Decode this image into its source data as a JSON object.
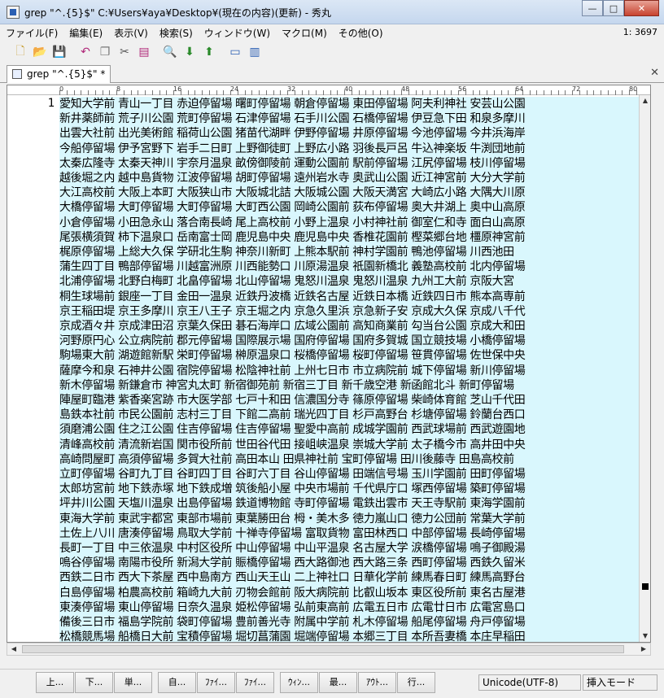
{
  "window": {
    "title": "grep \"^.{5}$\" C:¥Users¥aya¥Desktop¥(現在の内容)(更新) - 秀丸",
    "minimize": "—",
    "maximize": "□",
    "close": "✕"
  },
  "menubar": {
    "items": [
      "ファイル(F)",
      "編集(E)",
      "表示(V)",
      "検索(S)",
      "ウィンドウ(W)",
      "マクロ(M)",
      "その他(O)"
    ],
    "position": "1: 3697"
  },
  "tab": {
    "label": "grep \"^.{5}$\" *",
    "close": "✕"
  },
  "ruler": {
    "marks": [
      "0",
      "8",
      "16",
      "24",
      "32",
      "40",
      "48",
      "56",
      "64",
      "72",
      "80"
    ]
  },
  "editor": {
    "line_number": "1",
    "lines": [
      "愛知大学前 青山一丁目 赤迫停留場 曙町停留場 朝倉停留場 東田停留場 阿夫利神社 安芸山公園",
      "新井薬師前 荒子川公園 荒町停留場 石津停留場 石手川公園 石橋停留場 伊豆急下田 和泉多摩川",
      "出雲大社前 出光美術館 稲荷山公園 猪苗代湖畔 伊野停留場 井原停留場 今池停留場 今井浜海岸",
      "今船停留場 伊予宮野下 岩手二日町 上野御徒町 上野広小路 羽後長戸呂 牛込神楽坂 牛渕団地前",
      "太秦広隆寺 太秦天神川 宇奈月温泉 畝傍御陵前 運動公園前 駅前停留場 江尻停留場 枝川停留場",
      "越後堀之内 越中島貨物 江波停留場 胡町停留場 遠州岩水寺 奥武山公園 近江神宮前 大分大学前",
      "大江高校前 大阪上本町 大阪狭山市 大阪城北詰 大阪城公園 大阪天満宮 大崎広小路 大隅大川原",
      "大橋停留場 大町停留場 大町停留場 大町西公園 岡崎公園前 荻布停留場 奥大井湖上 奥中山高原",
      "小倉停留場 小田急永山 落合南長崎 尾上高校前 小野上温泉 小村神社前 御室仁和寺 面白山高原",
      "尾張横須賀 柿下温泉口 岳南富士岡 鹿児島中央 鹿児島中央 香椎花園前 樫菜郷台地 橿原神宮前",
      "梶原停留場 上総大久保 学研北生駒 神奈川新町 上熊本駅前 神村学園前 鴨池停留場 川西池田",
      "蒲生四丁目 鴨部停留場 川越富洲原 川西能勢口 川原湯温泉 祇園新橋北 義塾高校前 北内停留場",
      "北浦停留場 北野白梅町 北畠停留場 北山停留場 鬼怒川温泉 鬼怒川温泉 九州工大前 京阪大宮",
      "桐生球場前 銀座一丁目 金田一温泉 近鉄丹波橋 近鉄名古屋 近鉄日本橋 近鉄四日市 熊本高専前",
      "京王稲田堤 京王多摩川 京王八王子 京王堀之内 京急久里浜 京急新子安 京成大久保 京成八千代",
      "京成酒々井 京成津田沼 京葉久保田 碁石海岸口 広域公園前 高知商業前 勾当台公園 京成大和田",
      "河野原円心 公立病院前 郡元停留場 国際展示場 国府停留場 国府多賀城 国立競技場 小橋停留場",
      "駒場東大前 湖遊館新駅 栄町停留場 榊原温泉口 桜橋停留場 桜町停留場 笹貫停留場 佐世保中央",
      "薩摩今和泉 石神井公園 宿院停留場 松陰神社前 上州七日市 市立病院前 城下停留場 新川停留場",
      "新木停留場 新鎌倉市 神宮丸太町 新宿御苑前 新宿三丁目 新千歳空港 新函館北斗 新町停留場",
      "陣屋町臨港 紫香楽宮跡 市大医学部 七戸十和田 信濃国分寺 篠原停留場 柴崎体育館 芝山千代田",
      "島鉄本社前 市民公園前 志村三丁目 下館二高前 瑞光四丁目 杉戸高野台 杉塘停留場 鈴蘭台西口",
      "須磨浦公園 住之江公園 住吉停留場 住吉停留場 聖愛中高前 成城学園前 西武球場前 西武遊園地",
      "清峰高校前 清流新岩国 関市役所前 世田谷代田 接岨峡温泉 崇城大学前 太子橋今市 高井田中央",
      "高崎問屋町 高須停留場 多賀大社前 高田本山 田県神社前 宝町停留場 田川後藤寺 田島高校前",
      "立町停留場 谷町九丁目 谷町四丁目 谷町六丁目 谷山停留場 田端信号場 玉川学園前 田町停留場",
      "太郎坊宮前 地下鉄赤塚 地下鉄成増 筑後船小屋 中央市場前 千代県庁口 塚西停留場 築町停留場",
      "坪井川公園 天塩川温泉 出島停留場 鉄道博物館 寺町停留場 電鉄出雲市 天王寺駅前 東海学園前",
      "東海大学前 東武宇都宮 東部市場前 東葉勝田台 栂・美木多 徳力嵐山口 徳力公団前 常葉大学前",
      "土佐上八川 唐湊停留場 鳥取大学前 十禅寺停留場 富取貨物 富田林西口 中部停留場 長崎停留場",
      "長町一丁目 中三依温泉 中村区役所 中山停留場 中山平温泉 名古屋大学 涙橋停留場 鳴子御殿湯",
      "鳴谷停留場 南陽市役所 新潟大学前 賑橋停留場 西大路御池 西大路三条 西町停留場 西鉄久留米",
      "西鉄二日市 西大下茶屋 西中島南方 西山天王山 二上神社口 日華化学前 練馬春日町 練馬高野台",
      "白島停留場 柏農高校前 箱崎九大前 刃物会館前 阪大病院前 比叡山坂本 東区役所前 東名古屋港",
      "東湊停留場 東山停留場 日奈久温泉 姫松停留場 弘前東高前 広電五日市 広電廿日市 広電宮島口",
      "備後三日市 福島学院前 袋町停留場 豊前善光寺 附属中学前 札木停留場 船尾停留場 舟戸停留場",
      "松橋競馬場 船橋日大前 宝積停留場 堀切菖蒲園 堀端停留場 本郷三丁目 本所吾妻橋 本庄早稲田",
      "前畑停留場 枡形停留場 松尾八幡平 松島二丁目 松虫停留場 三島広小路 三島二日町 瑞穂区役所",
      "三菱自工前 南富山駅前 南町停留場 都通停留場 向原停留場 武蔵五日市 武蔵小金井 六会日大前",
      "室生口大野 明治神宮前 名鉄名古屋 名電各務原 百舌鳥八幡 桃山御陵前 森町病院前 八栗登山口",
      "屋代高校前 八頭高校前 八千代中央 柳川停留場 大和西大寺 湯西川温泉 湯野上温泉 横須賀中央",
      "葭池温泉前 吉久停留場 四谷三丁目 代々木上原 代々木公園 代々木八幡 嵐電天神川 脇田停留場"
    ]
  },
  "funcbar": {
    "keys": [
      "上...",
      "下...",
      "単...",
      "自...",
      "ﾌｧｲ...",
      "ﾌｧｲ...",
      "ｳｨﾝ...",
      "最...",
      "ｱｳﾄ...",
      "行..."
    ]
  },
  "status": {
    "encoding": "Unicode(UTF-8)",
    "mode": "挿入モード"
  }
}
